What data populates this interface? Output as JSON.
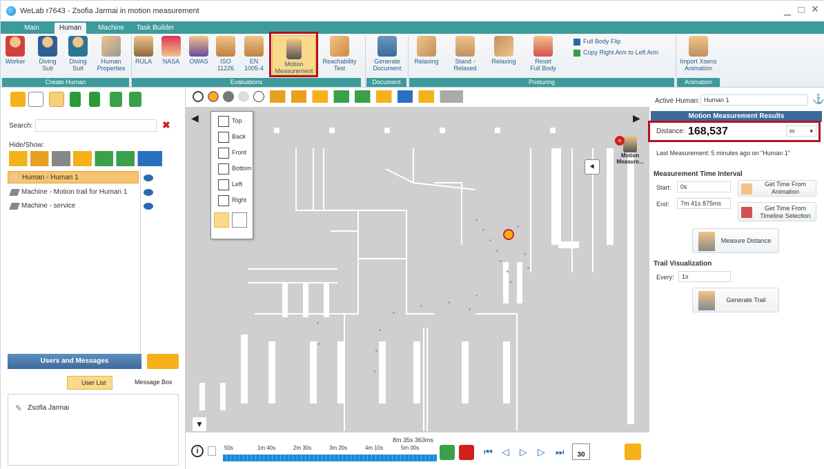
{
  "app": {
    "title": "WeLab r7643 - Zsofia Jarmai in motion measurement",
    "minimize": "_",
    "maximize": "□",
    "close": "×"
  },
  "tabs": [
    {
      "label": "Main"
    },
    {
      "label": "Human"
    },
    {
      "label": "Machine"
    },
    {
      "label": "Task Builder"
    }
  ],
  "ribbon": {
    "create_human": {
      "group": "Create Human",
      "worker": "Worker",
      "diving_suit_1": "Diving Suit",
      "diving_suit_2": "Diving Suit",
      "human_properties": "Human Properties"
    },
    "evaluations": {
      "group": "Evaluations",
      "rula": "RULA",
      "nasa": "NASA",
      "owas": "OWAS",
      "iso": "ISO 11226",
      "en": "EN 1005-4",
      "motion": "Motion Measurement",
      "reach": "Reachability Test"
    },
    "document": {
      "group": "Document",
      "generate": "Generate Document"
    },
    "posturing": {
      "group": "Posturing",
      "relaxing1": "Relaxing",
      "stand": "Stand - Relaxed",
      "relaxing2": "Relaxing",
      "reset": "Reset Full Body",
      "flip": "Full Body Flip",
      "copy": "Copy Right Arm to Left Arm"
    },
    "animation": {
      "group": "Animation",
      "import": "Import Xsens Animation"
    }
  },
  "left": {
    "search_label": "Search:",
    "search_value": "",
    "hideshow": "Hide/Show:",
    "tree": [
      {
        "label": "Human - Human 1"
      },
      {
        "label": "Machine - Motion trail for Human 1"
      },
      {
        "label": "Machine - service"
      }
    ],
    "users_title": "Users and Messages",
    "user_list": "User List",
    "message_box": "Message Box",
    "users": [
      {
        "name": "Zsofia Jarmai"
      }
    ]
  },
  "viewport": {
    "views": [
      "Top",
      "Back",
      "Front",
      "Bottom",
      "Left",
      "Right"
    ],
    "motion_label": "Motion Measure..."
  },
  "timeline": {
    "current": "8m 35s 363ms",
    "ticks": [
      "50s",
      "1m 40s",
      "2m 30s",
      "3m 20s",
      "4m 10s",
      "5m 00s"
    ],
    "speed": "30"
  },
  "right": {
    "active_human_label": "Active Human:",
    "active_human_value": "Human 1",
    "results_title": "Motion Measurement Results",
    "distance_label": "Distance:",
    "distance_value": "168,537",
    "distance_unit": "m",
    "last_measurement": "Last Measurement:  5 minutes ago on \"Human 1\"",
    "interval_title": "Measurement Time Interval",
    "start_label": "Start:",
    "start_value": "0s",
    "end_label": "End:",
    "end_value": "7m 41s 875ms",
    "get_anim": "Get Time From Animation",
    "get_timeline": "Get Time From Timeline Selection",
    "measure_btn": "Measure Distance",
    "trail_title": "Trail Visualization",
    "every_label": "Every:",
    "every_value": "1s",
    "generate_btn": "Generate Trail"
  },
  "colors": {
    "teal": "#3d9b9b",
    "highlight": "#b3121b",
    "selection": "#f7c36f",
    "trail": "#e870e8"
  }
}
